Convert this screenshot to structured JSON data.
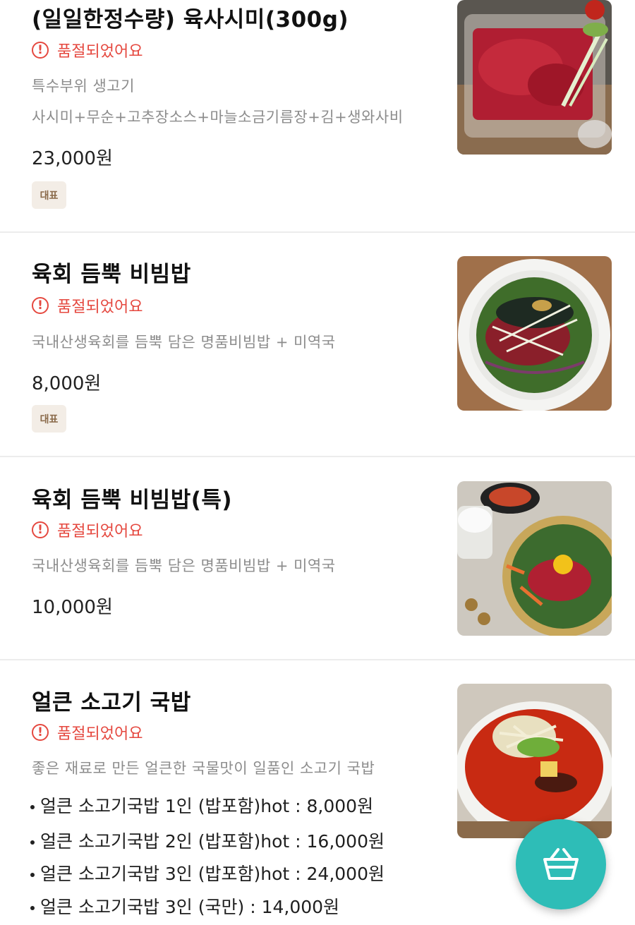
{
  "items": [
    {
      "title": "(일일한정수량) 육사시미(300g)",
      "status": "품절되었어요",
      "desc1": "특수부위 생고기",
      "desc2": "사시미+무순+고추장소스+마늘소금기름장+김+생와사비",
      "price": "23,000원",
      "badge": "대표"
    },
    {
      "title": "육회 듬뿍 비빔밥",
      "status": "품절되었어요",
      "desc1": "국내산생육회를 듬뿍 담은 명품비빔밥 +  미역국",
      "price": "8,000원",
      "badge": "대표"
    },
    {
      "title": "육회 듬뿍 비빔밥(특)",
      "status": "품절되었어요",
      "desc1": "국내산생육회를 듬뿍 담은 명품비빔밥 + 미역국",
      "price": "10,000원"
    },
    {
      "title": "얼큰 소고기 국밥",
      "status": "품절되었어요",
      "desc1": "좋은 재료로 만든 얼큰한 국물맛이 일품인 소고기 국밥",
      "options": [
        "얼큰 소고기국밥 1인 (밥포함)hot : 8,000원",
        "얼큰 소고기국밥 2인 (밥포함)hot : 16,000원",
        "얼큰 소고기국밥 3인 (밥포함)hot : 24,000원",
        "얼큰 소고기국밥 3인 (국만) : 14,000원"
      ]
    }
  ],
  "icons": {
    "soldout": "exclamation-circle-icon",
    "cart": "shopping-basket-icon"
  },
  "colors": {
    "soldout": "#e5483f",
    "badge_bg": "#f3ede6",
    "badge_text": "#8a6a4a",
    "fab": "#2ebdb7"
  }
}
